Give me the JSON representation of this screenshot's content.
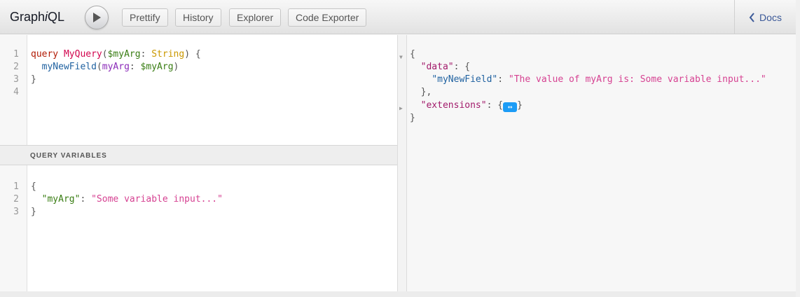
{
  "app": {
    "title_prefix": "Graph",
    "title_italic": "i",
    "title_suffix": "QL"
  },
  "toolbar": {
    "prettify": "Prettify",
    "history": "History",
    "explorer": "Explorer",
    "code_exporter": "Code Exporter",
    "docs": "Docs",
    "run_icon": "play-icon",
    "docs_icon": "chevron-left-icon"
  },
  "query_editor": {
    "line_numbers": [
      "1",
      "2",
      "3",
      "4"
    ],
    "line1": {
      "keyword": "query",
      "name": "MyQuery",
      "open_paren": "(",
      "variable": "$myArg",
      "colon": ":",
      "type": "String",
      "close": ") {"
    },
    "line2": {
      "field": "myNewField",
      "open_paren": "(",
      "arg": "myArg",
      "colon": ":",
      "variable": "$myArg",
      "close_paren": ")"
    },
    "line3": "}"
  },
  "variables_editor": {
    "header": "QUERY VARIABLES",
    "line_numbers": [
      "1",
      "2",
      "3"
    ],
    "line1": "{",
    "line2": {
      "key": "\"myArg\"",
      "colon": ":",
      "value": "\"Some variable input...\""
    },
    "line3": "}"
  },
  "result": {
    "line1": "{",
    "data_key": "\"data\"",
    "data_open": ": {",
    "field_key": "\"myNewField\"",
    "field_value": "\"The value of myArg is: Some variable input...\"",
    "data_close": "},",
    "extensions_key": "\"extensions\"",
    "extensions_open": ": {",
    "ellipsis_icon": "↔",
    "extensions_close": "}",
    "last": "}",
    "fold_open": "▼",
    "fold_closed": "▶"
  },
  "colors": {
    "keyword": "#b11a04",
    "definition": "#d2054e",
    "variable": "#397d13",
    "type": "#ca9800",
    "property": "#1f61a0",
    "attribute": "#8b2bb9",
    "string": "#d64292",
    "link": "#3b5998"
  }
}
